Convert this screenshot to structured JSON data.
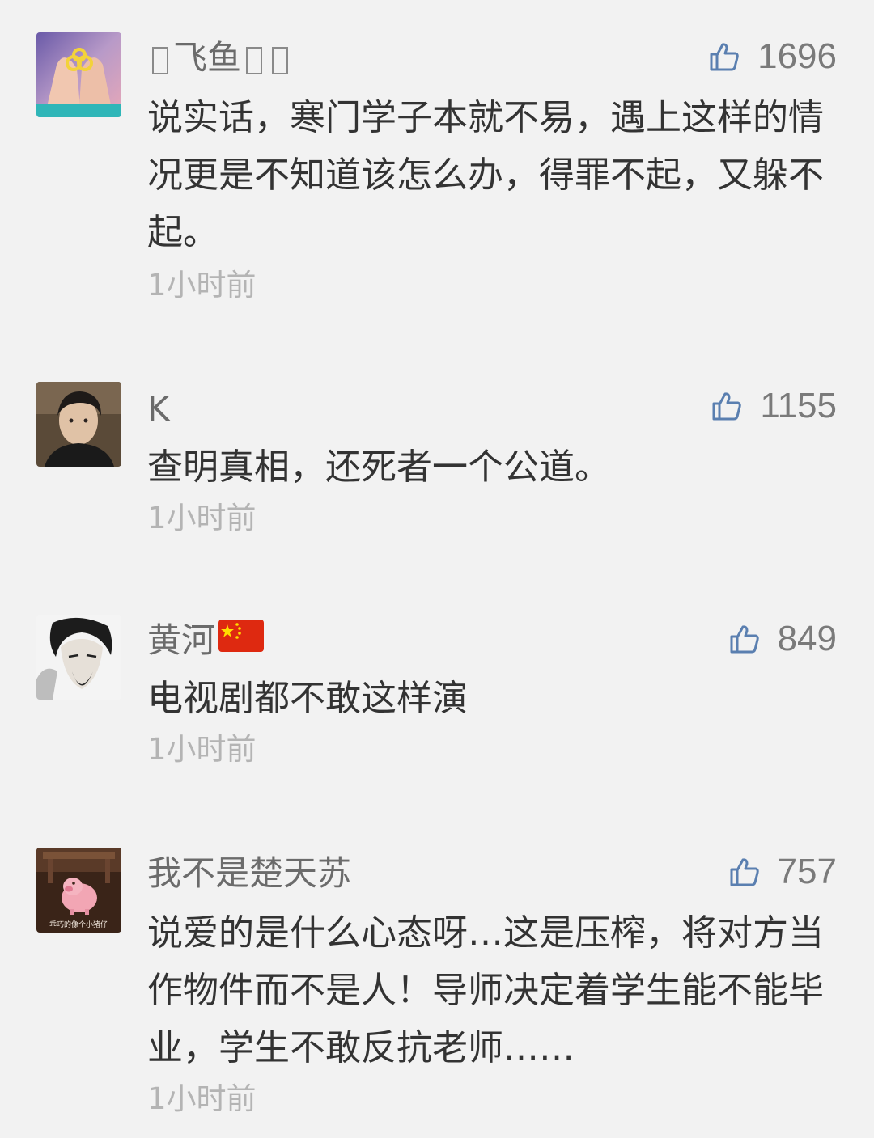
{
  "comments": [
    {
      "username": "飞鱼",
      "likes": "1696",
      "text": "说实话，寒门学子本就不易，遇上这样的情况更是不知道该怎么办，得罪不起，又躲不起。",
      "time": "1小时前"
    },
    {
      "username": "K",
      "likes": "1155",
      "text": "查明真相，还死者一个公道。",
      "time": "1小时前"
    },
    {
      "username": "黄河",
      "likes": "849",
      "text": "电视剧都不敢这样演",
      "time": "1小时前"
    },
    {
      "username": "我不是楚天苏",
      "likes": "757",
      "text": "说爱的是什么心态呀…这是压榨，将对方当作物件而不是人！导师决定着学生能不能毕业，学生不敢反抗老师……",
      "time": "1小时前",
      "avatar_caption": "乖巧的像个小猪仔"
    }
  ],
  "icons": {
    "like": "thumbs-up-icon",
    "flag": "china-flag-icon"
  },
  "colors": {
    "background": "#f2f2f2",
    "like_icon": "#5a7fb0",
    "username": "#6b6b6b",
    "time": "#b4b4b4"
  }
}
